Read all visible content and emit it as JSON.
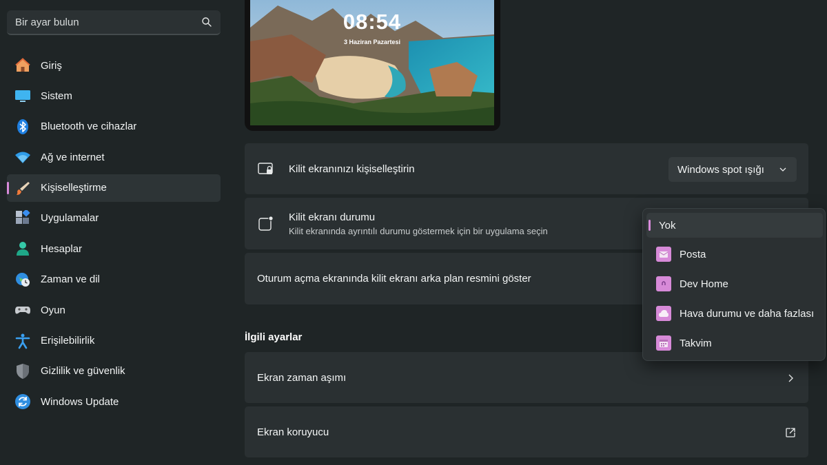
{
  "sidebar": {
    "search_placeholder": "Bir ayar bulun",
    "items": [
      {
        "label": "Giriş",
        "icon": "home-icon"
      },
      {
        "label": "Sistem",
        "icon": "monitor-icon"
      },
      {
        "label": "Bluetooth ve cihazlar",
        "icon": "bluetooth-icon"
      },
      {
        "label": "Ağ ve internet",
        "icon": "wifi-icon"
      },
      {
        "label": "Kişiselleştirme",
        "icon": "paintbrush-icon"
      },
      {
        "label": "Uygulamalar",
        "icon": "apps-icon"
      },
      {
        "label": "Hesaplar",
        "icon": "person-icon"
      },
      {
        "label": "Zaman ve dil",
        "icon": "globe-clock-icon"
      },
      {
        "label": "Oyun",
        "icon": "gamepad-icon"
      },
      {
        "label": "Erişilebilirlik",
        "icon": "accessibility-icon"
      },
      {
        "label": "Gizlilik ve güvenlik",
        "icon": "shield-icon"
      },
      {
        "label": "Windows Update",
        "icon": "update-icon"
      }
    ],
    "selected": "Kişiselleştirme"
  },
  "preview": {
    "time": "08:54",
    "date": "3 Haziran Pazartesi"
  },
  "settings": {
    "personalize_lock": {
      "title": "Kilit ekranınızı kişiselleştirin",
      "value": "Windows spot ışığı"
    },
    "lock_status": {
      "title": "Kilit ekranı durumu",
      "subtitle": "Kilit ekranında ayrıntılı durumu göstermek için bir uygulama seçin"
    },
    "show_background": {
      "title": "Oturum açma ekranında kilit ekranı arka plan resmini göster"
    }
  },
  "related": {
    "heading": "İlgili ayarlar",
    "screen_timeout": "Ekran zaman aşımı",
    "screensaver": "Ekran koruyucu"
  },
  "status_menu": {
    "selected": "Yok",
    "options": [
      {
        "label": "Yok"
      },
      {
        "label": "Posta",
        "icon": "mail-app-icon"
      },
      {
        "label": "Dev Home",
        "icon": "devhome-app-icon"
      },
      {
        "label": "Hava durumu ve daha fazlası",
        "icon": "weather-app-icon"
      },
      {
        "label": "Takvim",
        "icon": "calendar-app-icon"
      }
    ]
  },
  "colors": {
    "accent": "#d98bdb",
    "background": "#1f2526",
    "card": "#2a3032"
  }
}
